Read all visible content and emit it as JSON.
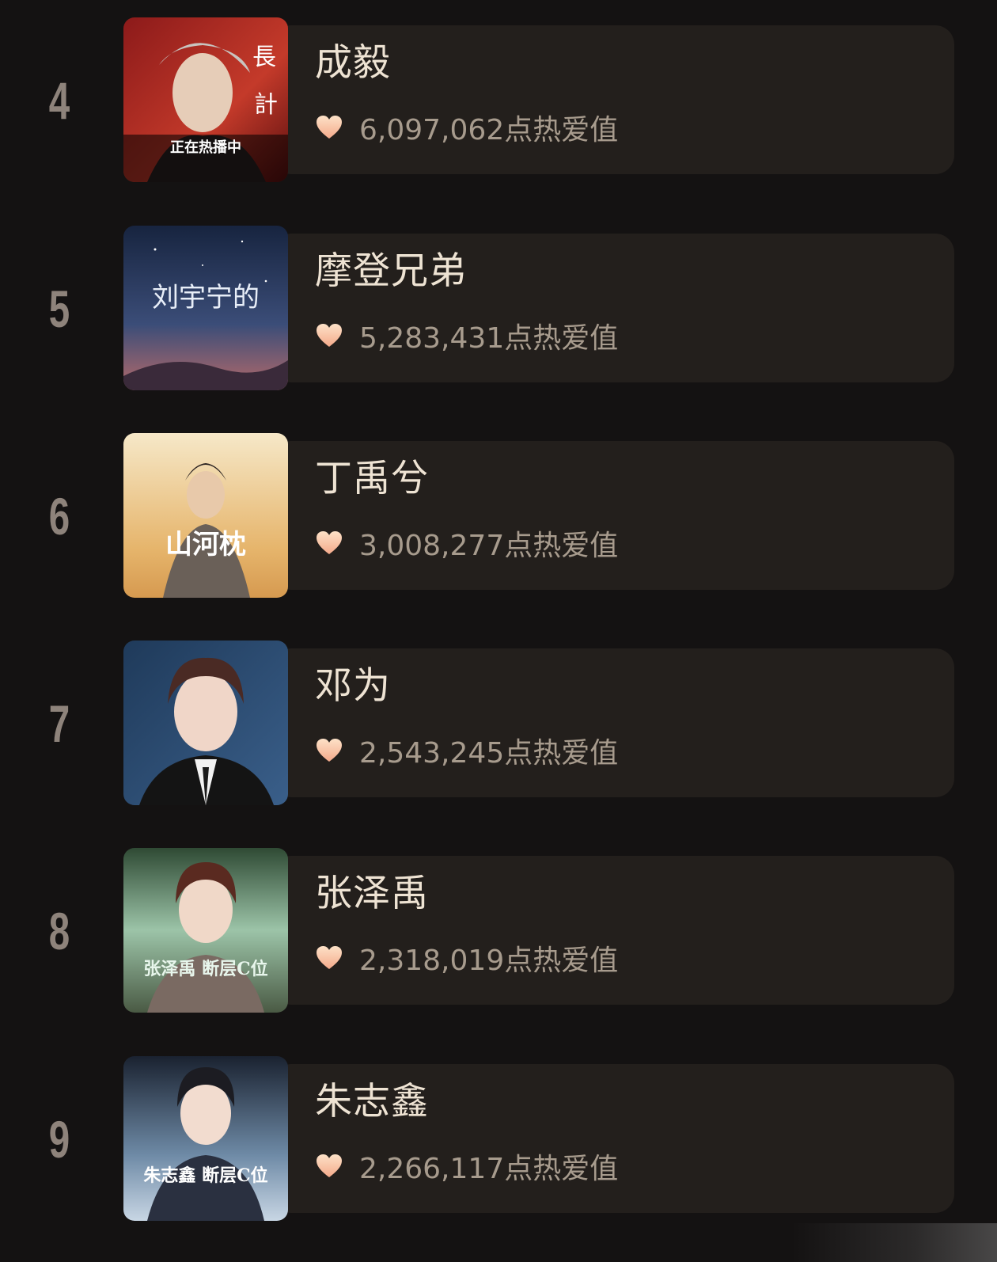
{
  "ranking": {
    "entries": [
      {
        "rank": "4",
        "name": "成毅",
        "heat_value": "6,097,062",
        "heat_unit": "点热爱值",
        "thumb_text": "正在热播中",
        "thumb_colors": [
          "#8c1a1a",
          "#c43a2a",
          "#f0e8e0"
        ]
      },
      {
        "rank": "5",
        "name": "摩登兄弟",
        "heat_value": "5,283,431",
        "heat_unit": "点热爱值",
        "thumb_text": "刘宇宁的",
        "thumb_colors": [
          "#17243f",
          "#3b4d78",
          "#b56a6a"
        ]
      },
      {
        "rank": "6",
        "name": "丁禹兮",
        "heat_value": "3,008,277",
        "heat_unit": "点热爱值",
        "thumb_text": "山河枕",
        "thumb_colors": [
          "#f6e8c8",
          "#e6b56c",
          "#5b4a3e"
        ]
      },
      {
        "rank": "7",
        "name": "邓为",
        "heat_value": "2,543,245",
        "heat_unit": "点热爱值",
        "thumb_text": "",
        "thumb_colors": [
          "#1f3a5a",
          "#3a5f8a",
          "#101010"
        ]
      },
      {
        "rank": "8",
        "name": "张泽禹",
        "heat_value": "2,318,019",
        "heat_unit": "点热爱值",
        "thumb_text": "张泽禹 断层C位",
        "thumb_colors": [
          "#2f4a34",
          "#9cc4a8",
          "#5a4a44"
        ]
      },
      {
        "rank": "9",
        "name": "朱志鑫",
        "heat_value": "2,266,117",
        "heat_unit": "点热爱值",
        "thumb_text": "朱志鑫 断层C位",
        "thumb_colors": [
          "#1a2230",
          "#6e8aa6",
          "#e8eef4"
        ]
      }
    ]
  },
  "colors": {
    "background": "#141212",
    "card": "#231f1c",
    "rank": "#8e837b",
    "name": "#eee3d3",
    "value": "#a79b8d",
    "heart_light": "#fde2c8",
    "heart_dark": "#f4a98a"
  },
  "icons": {
    "heart": "heart-icon"
  }
}
